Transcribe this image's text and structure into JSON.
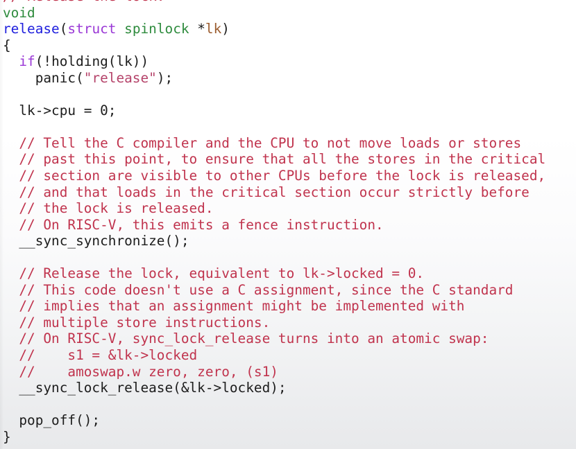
{
  "document": {
    "kind": "source-code-listing",
    "language": "C",
    "function": "release",
    "background_top_color": "#ffffff",
    "background_bottom_color": "#e8e9eb"
  },
  "palette": {
    "plain": "#1c1c1c",
    "comment": "#c0334d",
    "keyword": "#9a38d6",
    "type": "#2e8b3d",
    "function": "#2020dd",
    "variable": "#9b5c2e",
    "string": "#b5436a"
  },
  "code": {
    "lines": [
      {
        "id": "line-comment-release-the-lock",
        "clipped": true,
        "tokens": [
          {
            "text": "// Release the lock.",
            "cls": "t-comment"
          }
        ]
      },
      {
        "id": "line-void",
        "tokens": [
          {
            "text": "void",
            "cls": "t-type"
          }
        ]
      },
      {
        "id": "line-signature",
        "tokens": [
          {
            "text": "release",
            "cls": "t-func"
          },
          {
            "text": "(",
            "cls": "t-punct"
          },
          {
            "text": "struct",
            "cls": "t-keyword"
          },
          {
            "text": " ",
            "cls": "t-plain"
          },
          {
            "text": "spinlock",
            "cls": "t-type"
          },
          {
            "text": " *",
            "cls": "t-plain"
          },
          {
            "text": "lk",
            "cls": "t-var"
          },
          {
            "text": ")",
            "cls": "t-punct"
          }
        ]
      },
      {
        "id": "line-open-brace",
        "tokens": [
          {
            "text": "{",
            "cls": "t-punct"
          }
        ]
      },
      {
        "id": "line-if-holding",
        "tokens": [
          {
            "text": "  ",
            "cls": "t-plain"
          },
          {
            "text": "if",
            "cls": "t-keyword"
          },
          {
            "text": "(!holding(lk))",
            "cls": "t-plain"
          }
        ]
      },
      {
        "id": "line-panic",
        "tokens": [
          {
            "text": "    panic(",
            "cls": "t-plain"
          },
          {
            "text": "\"release\"",
            "cls": "t-string"
          },
          {
            "text": ");",
            "cls": "t-plain"
          }
        ]
      },
      {
        "id": "line-blank-1",
        "tokens": [
          {
            "text": " ",
            "cls": "t-plain"
          }
        ]
      },
      {
        "id": "line-lk-cpu",
        "tokens": [
          {
            "text": "  lk->cpu = 0;",
            "cls": "t-plain"
          }
        ]
      },
      {
        "id": "line-blank-2",
        "tokens": [
          {
            "text": " ",
            "cls": "t-plain"
          }
        ]
      },
      {
        "id": "line-comment-tell-compiler",
        "tokens": [
          {
            "text": "  // Tell the C compiler and the CPU to not move loads or stores",
            "cls": "t-comment"
          }
        ]
      },
      {
        "id": "line-comment-past-this-point",
        "tokens": [
          {
            "text": "  // past this point, to ensure that all the stores in the critical",
            "cls": "t-comment"
          }
        ]
      },
      {
        "id": "line-comment-section-visible",
        "tokens": [
          {
            "text": "  // section are visible to other CPUs before the lock is released,",
            "cls": "t-comment"
          }
        ]
      },
      {
        "id": "line-comment-loads-critical",
        "tokens": [
          {
            "text": "  // and that loads in the critical section occur strictly before",
            "cls": "t-comment"
          }
        ]
      },
      {
        "id": "line-comment-lock-released",
        "tokens": [
          {
            "text": "  // the lock is released.",
            "cls": "t-comment"
          }
        ]
      },
      {
        "id": "line-comment-riscv-fence",
        "tokens": [
          {
            "text": "  // On RISC-V, this emits a fence instruction.",
            "cls": "t-comment"
          }
        ]
      },
      {
        "id": "line-sync-synchronize",
        "tokens": [
          {
            "text": "  __sync_synchronize();",
            "cls": "t-plain"
          }
        ]
      },
      {
        "id": "line-blank-3",
        "tokens": [
          {
            "text": " ",
            "cls": "t-plain"
          }
        ]
      },
      {
        "id": "line-comment-release-equivalent",
        "tokens": [
          {
            "text": "  // Release the lock, equivalent to lk->locked = 0.",
            "cls": "t-comment"
          }
        ]
      },
      {
        "id": "line-comment-no-c-assignment",
        "tokens": [
          {
            "text": "  // This code doesn't use a C assignment, since the C standard",
            "cls": "t-comment"
          }
        ]
      },
      {
        "id": "line-comment-implies-assignment",
        "tokens": [
          {
            "text": "  // implies that an assignment might be implemented with",
            "cls": "t-comment"
          }
        ]
      },
      {
        "id": "line-comment-multiple-stores",
        "tokens": [
          {
            "text": "  // multiple store instructions.",
            "cls": "t-comment"
          }
        ]
      },
      {
        "id": "line-comment-riscv-atomic-swap",
        "tokens": [
          {
            "text": "  // On RISC-V, sync_lock_release turns into an atomic swap:",
            "cls": "t-comment"
          }
        ]
      },
      {
        "id": "line-comment-s1-assign",
        "tokens": [
          {
            "text": "  //    s1 = &lk->locked",
            "cls": "t-comment"
          }
        ]
      },
      {
        "id": "line-comment-amoswap",
        "tokens": [
          {
            "text": "  //    amoswap.w zero, zero, (s1)",
            "cls": "t-comment"
          }
        ]
      },
      {
        "id": "line-sync-lock-release",
        "tokens": [
          {
            "text": "  __sync_lock_release(&lk->locked);",
            "cls": "t-plain"
          }
        ]
      },
      {
        "id": "line-blank-4",
        "tokens": [
          {
            "text": " ",
            "cls": "t-plain"
          }
        ]
      },
      {
        "id": "line-pop-off",
        "tokens": [
          {
            "text": "  pop_off();",
            "cls": "t-plain"
          }
        ]
      },
      {
        "id": "line-close-brace",
        "tokens": [
          {
            "text": "}",
            "cls": "t-punct"
          }
        ]
      }
    ]
  }
}
